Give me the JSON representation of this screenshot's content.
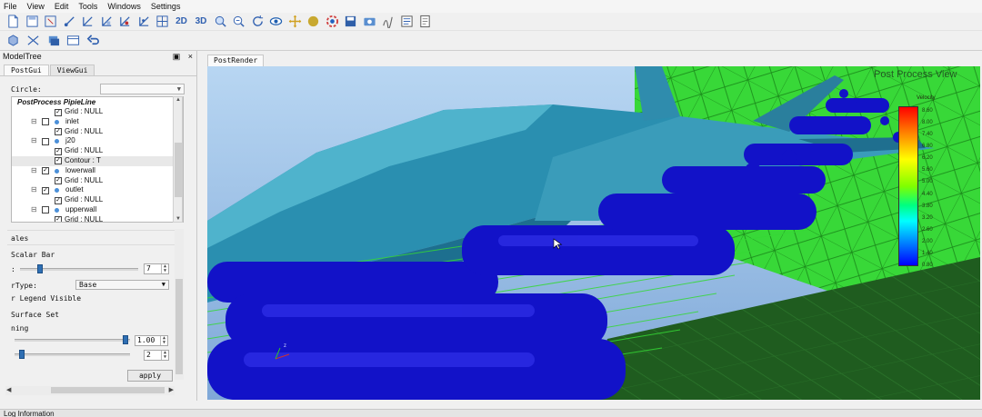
{
  "menu": [
    "File",
    "View",
    "Edit",
    "Tools",
    "Windows",
    "Settings"
  ],
  "toolbar": {
    "icons_row1": [
      "new-file-icon",
      "save-icon",
      "select-box-icon",
      "select-nodes-icon",
      "select-edges-icon",
      "select-faces-icon",
      "select-cells-icon",
      "select-points-icon",
      "grid-select-icon"
    ],
    "label_2d": "2D",
    "label_3d": "3D",
    "icons_row1b": [
      "fit-view-icon",
      "zoom-icon",
      "rotate-icon",
      "eye-icon",
      "move-icon",
      "sphere-icon",
      "render-settings-icon",
      "save-image-icon",
      "screenshot-icon",
      "script-icon",
      "checklist-icon",
      "document-icon"
    ],
    "icons_row2": [
      "import-geometry-icon",
      "mesh-tool-icon",
      "layers-icon",
      "table-icon",
      "undo-icon"
    ]
  },
  "dock": {
    "title": "ModelTree",
    "float_label": "▣",
    "close_label": "×",
    "tabs": [
      "PostGui",
      "ViewGui"
    ],
    "circle_label": "Circle:",
    "tree_header": "PostProcess PipieLine",
    "tree": [
      {
        "level": 3,
        "checked": true,
        "label": "Grid : NULL"
      },
      {
        "level": 2,
        "checked": false,
        "label": "inlet"
      },
      {
        "level": 3,
        "checked": true,
        "label": "Grid : NULL"
      },
      {
        "level": 2,
        "checked": false,
        "label": "j20"
      },
      {
        "level": 3,
        "checked": true,
        "label": "Grid : NULL"
      },
      {
        "level": 3,
        "checked": true,
        "label": "Contour : T",
        "selected": true
      },
      {
        "level": 2,
        "checked": true,
        "label": "lowerwall"
      },
      {
        "level": 3,
        "checked": true,
        "label": "Grid : NULL"
      },
      {
        "level": 2,
        "checked": true,
        "label": "outlet"
      },
      {
        "level": 3,
        "checked": true,
        "label": "Grid : NULL"
      },
      {
        "level": 2,
        "checked": false,
        "label": "upperwall"
      },
      {
        "level": 3,
        "checked": true,
        "label": "Grid : NULL"
      }
    ],
    "props": {
      "section_scales": "ales",
      "scalar_bar": "Scalar Bar",
      "colon_label": ":",
      "spin1_value": "7",
      "type_label": "rType:",
      "type_value": "Base",
      "legend_visible": "r Legend Visible",
      "surface_set": "Surface Set",
      "ning_label": "ning",
      "spin2_value": "1.00",
      "spin3_value": "2",
      "apply_label": "apply",
      "slider1_level": 0.15,
      "slider2_level": 0.98,
      "slider3_level": 0.04
    }
  },
  "render": {
    "tab_label": "PostRender",
    "view_title": "Post Process View",
    "legend_title": "Velocity",
    "legend_ticks": [
      "8.60",
      "8.00",
      "7.40",
      "6.80",
      "6.20",
      "5.60",
      "5.00",
      "4.40",
      "3.80",
      "3.20",
      "2.60",
      "2.00",
      "1.40",
      "0.80"
    ]
  },
  "log": {
    "title": "Log Information"
  },
  "colors": {
    "mesh_green": "#2ecc2e",
    "jet_teal": "#2a8fb0",
    "streamline_blue": "#1212c8",
    "icon_blue": "#3060b0"
  }
}
